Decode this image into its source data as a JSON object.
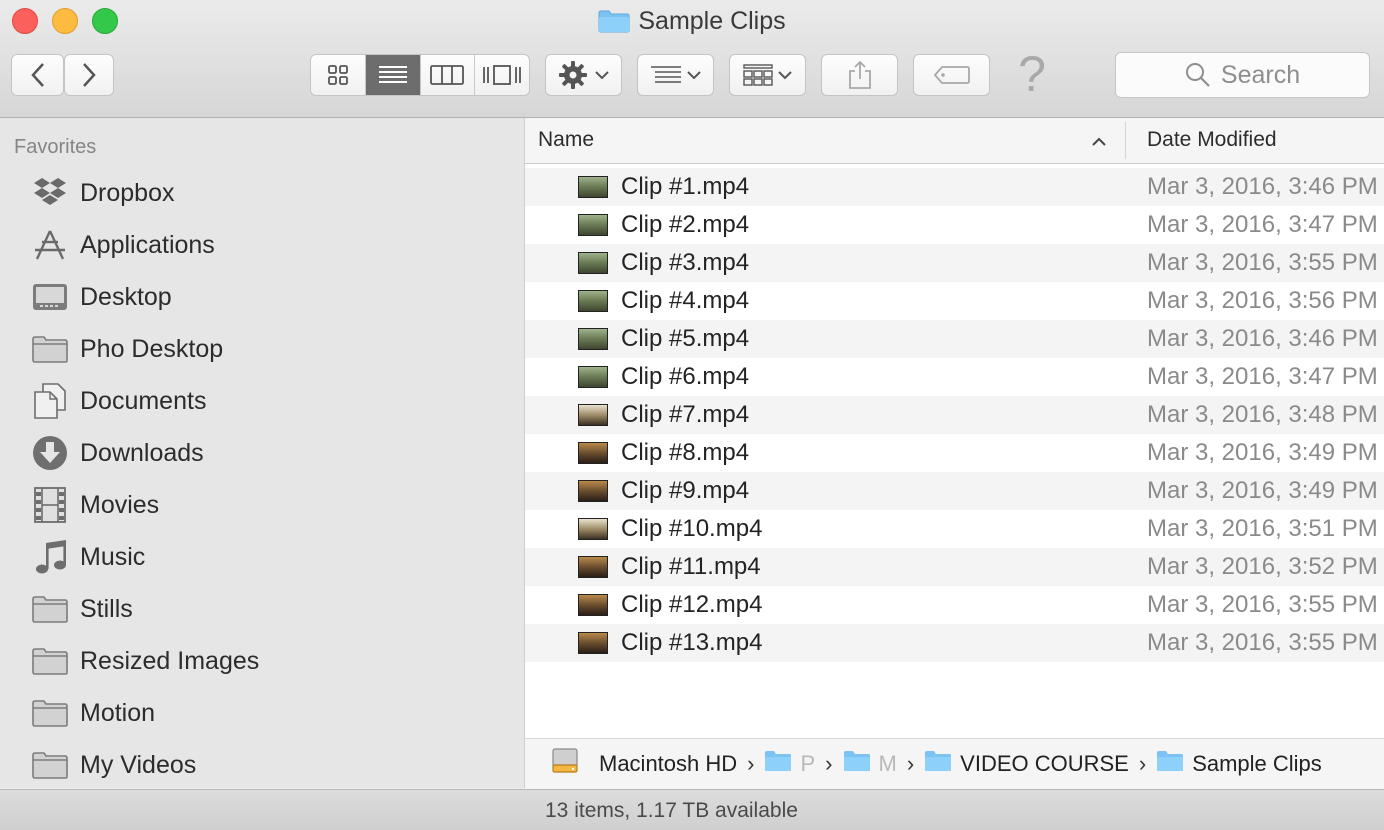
{
  "window": {
    "title": "Sample Clips",
    "title_icon": "folder-icon",
    "accent_folder_color": "#7cc3f3"
  },
  "toolbar": {
    "back_icon": "chevron-left-icon",
    "forward_icon": "chevron-right-icon",
    "view_modes": [
      "icon-view",
      "list-view",
      "column-view",
      "cover-flow-view"
    ],
    "active_view": "list-view",
    "action_icon": "gear-icon",
    "arrange_icon": "arrange-lines-icon",
    "group_icon": "group-grid-icon",
    "share_icon": "share-icon",
    "tag_icon": "tag-icon",
    "help_glyph": "?",
    "search_placeholder": "Search"
  },
  "sidebar": {
    "heading": "Favorites",
    "items": [
      {
        "label": "Dropbox",
        "icon": "dropbox-icon"
      },
      {
        "label": "Applications",
        "icon": "applications-icon"
      },
      {
        "label": "Desktop",
        "icon": "desktop-icon"
      },
      {
        "label": "Pho Desktop",
        "icon": "folder-icon"
      },
      {
        "label": "Documents",
        "icon": "documents-icon"
      },
      {
        "label": "Downloads",
        "icon": "downloads-icon"
      },
      {
        "label": "Movies",
        "icon": "movies-icon"
      },
      {
        "label": "Music",
        "icon": "music-icon"
      },
      {
        "label": "Stills",
        "icon": "folder-icon"
      },
      {
        "label": "Resized Images",
        "icon": "folder-icon"
      },
      {
        "label": "Motion",
        "icon": "folder-icon"
      },
      {
        "label": "My Videos",
        "icon": "folder-icon"
      }
    ]
  },
  "list": {
    "columns": {
      "name": "Name",
      "date": "Date Modified"
    },
    "sort_indicator": "chevron-up-icon",
    "files": [
      {
        "name": "Clip #1.mp4",
        "date": "Mar 3, 2016, 3:46 PM"
      },
      {
        "name": "Clip #2.mp4",
        "date": "Mar 3, 2016, 3:47 PM"
      },
      {
        "name": "Clip #3.mp4",
        "date": "Mar 3, 2016, 3:55 PM"
      },
      {
        "name": "Clip #4.mp4",
        "date": "Mar 3, 2016, 3:56 PM"
      },
      {
        "name": "Clip #5.mp4",
        "date": "Mar 3, 2016, 3:46 PM"
      },
      {
        "name": "Clip #6.mp4",
        "date": "Mar 3, 2016, 3:47 PM"
      },
      {
        "name": "Clip #7.mp4",
        "date": "Mar 3, 2016, 3:48 PM"
      },
      {
        "name": "Clip #8.mp4",
        "date": "Mar 3, 2016, 3:49 PM"
      },
      {
        "name": "Clip #9.mp4",
        "date": "Mar 3, 2016, 3:49 PM"
      },
      {
        "name": "Clip #10.mp4",
        "date": "Mar 3, 2016, 3:51 PM"
      },
      {
        "name": "Clip #11.mp4",
        "date": "Mar 3, 2016, 3:52 PM"
      },
      {
        "name": "Clip #12.mp4",
        "date": "Mar 3, 2016, 3:55 PM"
      },
      {
        "name": "Clip #13.mp4",
        "date": "Mar 3, 2016, 3:55 PM"
      }
    ]
  },
  "pathbar": {
    "disk": "Macintosh HD",
    "truncated_1": "P",
    "truncated_2": "M",
    "folder_3": "VIDEO COURSE",
    "folder_4": "Sample Clips"
  },
  "status": {
    "text": "13 items, 1.17 TB available"
  }
}
